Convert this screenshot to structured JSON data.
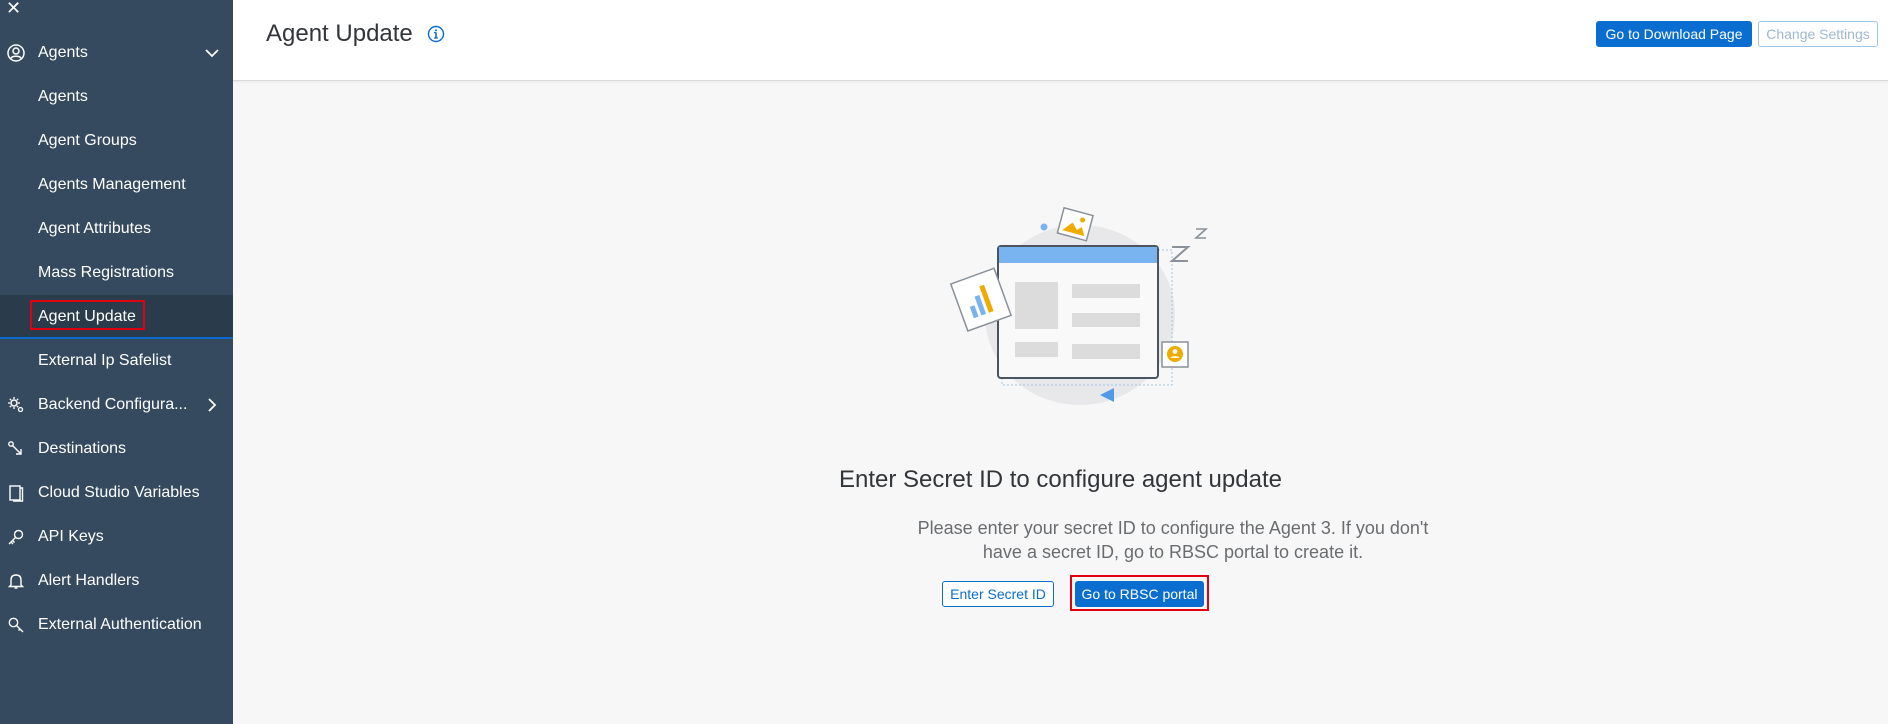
{
  "sidebar": {
    "close_glyph": "✕",
    "items": [
      {
        "label": "Agents",
        "icon": "user-icon",
        "expandable": "expanded"
      },
      {
        "label": "Agents"
      },
      {
        "label": "Agent Groups"
      },
      {
        "label": "Agents Management"
      },
      {
        "label": "Agent Attributes"
      },
      {
        "label": "Mass Registrations"
      },
      {
        "label": "Agent Update",
        "selected": true
      },
      {
        "label": "External Ip Safelist"
      },
      {
        "label": "Backend Configura...",
        "icon": "gear-icon",
        "expandable": "collapsed"
      },
      {
        "label": "Destinations",
        "icon": "destination-icon"
      },
      {
        "label": "Cloud Studio Variables",
        "icon": "document-icon"
      },
      {
        "label": "API Keys",
        "icon": "key-icon"
      },
      {
        "label": "Alert Handlers",
        "icon": "bell-icon"
      },
      {
        "label": "External Authentication",
        "icon": "key-search-icon"
      }
    ]
  },
  "header": {
    "title": "Agent Update",
    "download_label": "Go to Download Page",
    "change_settings_label": "Change Settings"
  },
  "main": {
    "empty_title": "Enter Secret ID to configure agent update",
    "empty_desc_line1": "Please enter your secret ID to configure the Agent 3. If you don't",
    "empty_desc_line2": "have a secret ID, go to RBSC portal to create it.",
    "enter_secret_label": "Enter Secret ID",
    "rbsc_label": "Go to RBSC portal"
  },
  "colors": {
    "sidebar_bg": "#354a5f",
    "accent": "#0a6ed1",
    "highlight_box": "#e0000f"
  }
}
